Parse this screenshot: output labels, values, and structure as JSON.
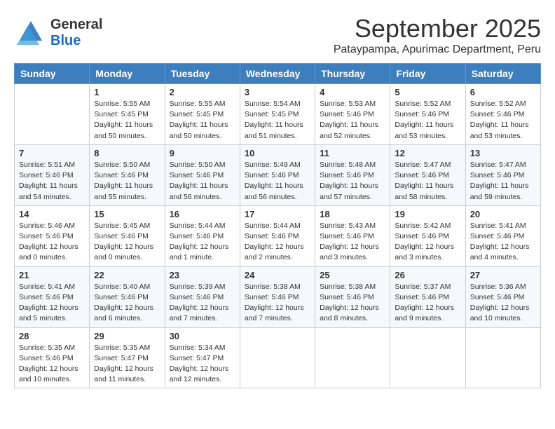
{
  "header": {
    "logo_general": "General",
    "logo_blue": "Blue",
    "month": "September 2025",
    "location": "Pataypampa, Apurimac Department, Peru"
  },
  "days_of_week": [
    "Sunday",
    "Monday",
    "Tuesday",
    "Wednesday",
    "Thursday",
    "Friday",
    "Saturday"
  ],
  "weeks": [
    [
      {
        "day": "",
        "info": ""
      },
      {
        "day": "1",
        "info": "Sunrise: 5:55 AM\nSunset: 5:45 PM\nDaylight: 11 hours\nand 50 minutes."
      },
      {
        "day": "2",
        "info": "Sunrise: 5:55 AM\nSunset: 5:45 PM\nDaylight: 11 hours\nand 50 minutes."
      },
      {
        "day": "3",
        "info": "Sunrise: 5:54 AM\nSunset: 5:45 PM\nDaylight: 11 hours\nand 51 minutes."
      },
      {
        "day": "4",
        "info": "Sunrise: 5:53 AM\nSunset: 5:46 PM\nDaylight: 11 hours\nand 52 minutes."
      },
      {
        "day": "5",
        "info": "Sunrise: 5:52 AM\nSunset: 5:46 PM\nDaylight: 11 hours\nand 53 minutes."
      },
      {
        "day": "6",
        "info": "Sunrise: 5:52 AM\nSunset: 5:46 PM\nDaylight: 11 hours\nand 53 minutes."
      }
    ],
    [
      {
        "day": "7",
        "info": "Sunrise: 5:51 AM\nSunset: 5:46 PM\nDaylight: 11 hours\nand 54 minutes."
      },
      {
        "day": "8",
        "info": "Sunrise: 5:50 AM\nSunset: 5:46 PM\nDaylight: 11 hours\nand 55 minutes."
      },
      {
        "day": "9",
        "info": "Sunrise: 5:50 AM\nSunset: 5:46 PM\nDaylight: 11 hours\nand 56 minutes."
      },
      {
        "day": "10",
        "info": "Sunrise: 5:49 AM\nSunset: 5:46 PM\nDaylight: 11 hours\nand 56 minutes."
      },
      {
        "day": "11",
        "info": "Sunrise: 5:48 AM\nSunset: 5:46 PM\nDaylight: 11 hours\nand 57 minutes."
      },
      {
        "day": "12",
        "info": "Sunrise: 5:47 AM\nSunset: 5:46 PM\nDaylight: 11 hours\nand 58 minutes."
      },
      {
        "day": "13",
        "info": "Sunrise: 5:47 AM\nSunset: 5:46 PM\nDaylight: 11 hours\nand 59 minutes."
      }
    ],
    [
      {
        "day": "14",
        "info": "Sunrise: 5:46 AM\nSunset: 5:46 PM\nDaylight: 12 hours\nand 0 minutes."
      },
      {
        "day": "15",
        "info": "Sunrise: 5:45 AM\nSunset: 5:46 PM\nDaylight: 12 hours\nand 0 minutes."
      },
      {
        "day": "16",
        "info": "Sunrise: 5:44 AM\nSunset: 5:46 PM\nDaylight: 12 hours\nand 1 minute."
      },
      {
        "day": "17",
        "info": "Sunrise: 5:44 AM\nSunset: 5:46 PM\nDaylight: 12 hours\nand 2 minutes."
      },
      {
        "day": "18",
        "info": "Sunrise: 5:43 AM\nSunset: 5:46 PM\nDaylight: 12 hours\nand 3 minutes."
      },
      {
        "day": "19",
        "info": "Sunrise: 5:42 AM\nSunset: 5:46 PM\nDaylight: 12 hours\nand 3 minutes."
      },
      {
        "day": "20",
        "info": "Sunrise: 5:41 AM\nSunset: 5:46 PM\nDaylight: 12 hours\nand 4 minutes."
      }
    ],
    [
      {
        "day": "21",
        "info": "Sunrise: 5:41 AM\nSunset: 5:46 PM\nDaylight: 12 hours\nand 5 minutes."
      },
      {
        "day": "22",
        "info": "Sunrise: 5:40 AM\nSunset: 5:46 PM\nDaylight: 12 hours\nand 6 minutes."
      },
      {
        "day": "23",
        "info": "Sunrise: 5:39 AM\nSunset: 5:46 PM\nDaylight: 12 hours\nand 7 minutes."
      },
      {
        "day": "24",
        "info": "Sunrise: 5:38 AM\nSunset: 5:46 PM\nDaylight: 12 hours\nand 7 minutes."
      },
      {
        "day": "25",
        "info": "Sunrise: 5:38 AM\nSunset: 5:46 PM\nDaylight: 12 hours\nand 8 minutes."
      },
      {
        "day": "26",
        "info": "Sunrise: 5:37 AM\nSunset: 5:46 PM\nDaylight: 12 hours\nand 9 minutes."
      },
      {
        "day": "27",
        "info": "Sunrise: 5:36 AM\nSunset: 5:46 PM\nDaylight: 12 hours\nand 10 minutes."
      }
    ],
    [
      {
        "day": "28",
        "info": "Sunrise: 5:35 AM\nSunset: 5:46 PM\nDaylight: 12 hours\nand 10 minutes."
      },
      {
        "day": "29",
        "info": "Sunrise: 5:35 AM\nSunset: 5:47 PM\nDaylight: 12 hours\nand 11 minutes."
      },
      {
        "day": "30",
        "info": "Sunrise: 5:34 AM\nSunset: 5:47 PM\nDaylight: 12 hours\nand 12 minutes."
      },
      {
        "day": "",
        "info": ""
      },
      {
        "day": "",
        "info": ""
      },
      {
        "day": "",
        "info": ""
      },
      {
        "day": "",
        "info": ""
      }
    ]
  ]
}
